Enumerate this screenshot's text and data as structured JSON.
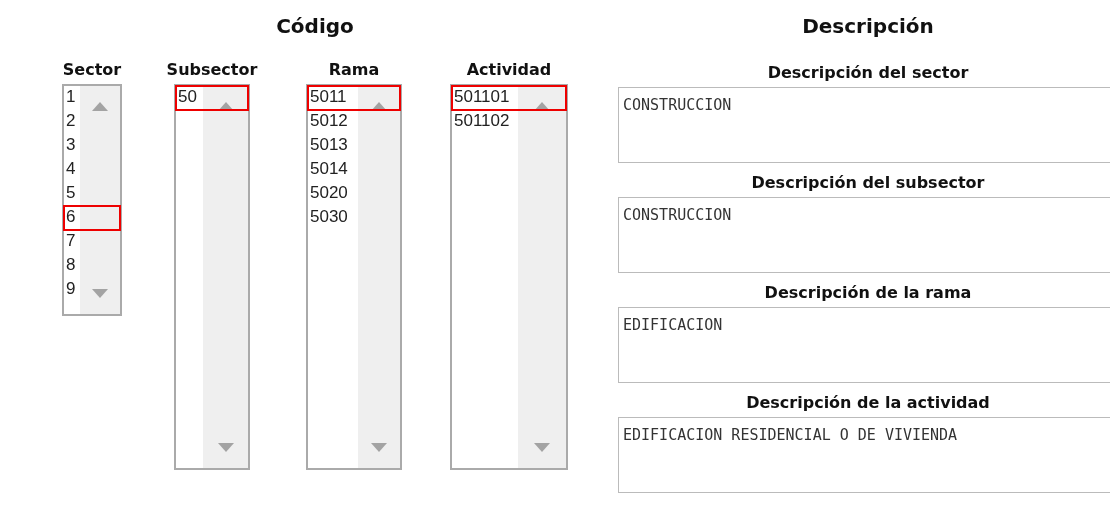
{
  "codigo": {
    "title": "Código",
    "lists": [
      {
        "label": "Sector",
        "items": [
          {
            "text": "1",
            "selected": false
          },
          {
            "text": "2",
            "selected": false
          },
          {
            "text": "3",
            "selected": false
          },
          {
            "text": "4",
            "selected": false
          },
          {
            "text": "5",
            "selected": false
          },
          {
            "text": "6",
            "selected": true
          },
          {
            "text": "7",
            "selected": false
          },
          {
            "text": "8",
            "selected": false
          },
          {
            "text": "9",
            "selected": false
          }
        ]
      },
      {
        "label": "Subsector",
        "items": [
          {
            "text": "50",
            "selected": true
          }
        ]
      },
      {
        "label": "Rama",
        "items": [
          {
            "text": "5011",
            "selected": true
          },
          {
            "text": "5012",
            "selected": false
          },
          {
            "text": "5013",
            "selected": false
          },
          {
            "text": "5014",
            "selected": false
          },
          {
            "text": "5020",
            "selected": false
          },
          {
            "text": "5030",
            "selected": false
          }
        ]
      },
      {
        "label": "Actividad",
        "items": [
          {
            "text": "501101",
            "selected": true
          },
          {
            "text": "501102",
            "selected": false
          }
        ]
      }
    ]
  },
  "descripcion": {
    "title": "Descripción",
    "fields": [
      {
        "label": "Descripción del sector",
        "value": "CONSTRUCCION"
      },
      {
        "label": "Descripción del subsector",
        "value": "CONSTRUCCION"
      },
      {
        "label": "Descripción de la rama",
        "value": "EDIFICACION"
      },
      {
        "label": "Descripción de la actividad",
        "value": "EDIFICACION RESIDENCIAL O DE VIVIENDA"
      }
    ]
  }
}
